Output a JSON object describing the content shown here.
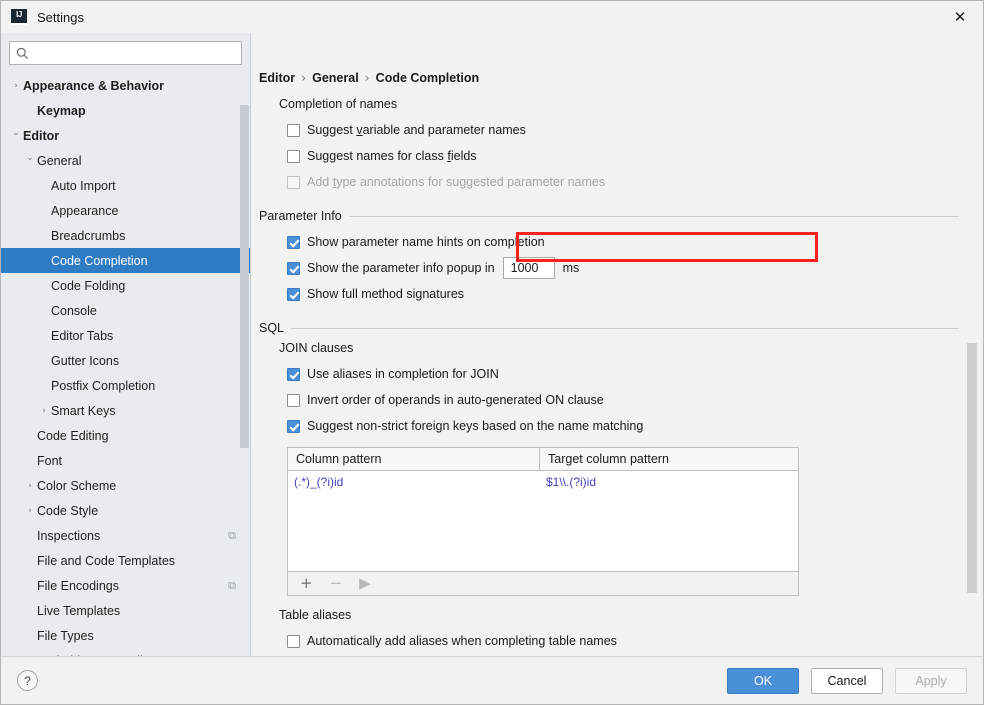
{
  "window": {
    "title": "Settings",
    "app_icon": "IJ",
    "close_icon": "✕"
  },
  "sidebar": {
    "search": {
      "value": "",
      "placeholder": "",
      "icon": "search-icon"
    },
    "items": [
      {
        "label": "Appearance & Behavior",
        "arrow": "›",
        "depth": 0,
        "bold": true,
        "selected": false,
        "badge": ""
      },
      {
        "label": "Keymap",
        "arrow": "",
        "depth": 1,
        "bold": true,
        "selected": false,
        "badge": ""
      },
      {
        "label": "Editor",
        "arrow": "⌄",
        "depth": 0,
        "bold": true,
        "selected": false,
        "badge": ""
      },
      {
        "label": "General",
        "arrow": "⌄",
        "depth": 1,
        "bold": false,
        "selected": false,
        "badge": ""
      },
      {
        "label": "Auto Import",
        "arrow": "",
        "depth": 2,
        "bold": false,
        "selected": false,
        "badge": ""
      },
      {
        "label": "Appearance",
        "arrow": "",
        "depth": 2,
        "bold": false,
        "selected": false,
        "badge": ""
      },
      {
        "label": "Breadcrumbs",
        "arrow": "",
        "depth": 2,
        "bold": false,
        "selected": false,
        "badge": ""
      },
      {
        "label": "Code Completion",
        "arrow": "",
        "depth": 2,
        "bold": false,
        "selected": true,
        "badge": ""
      },
      {
        "label": "Code Folding",
        "arrow": "",
        "depth": 2,
        "bold": false,
        "selected": false,
        "badge": ""
      },
      {
        "label": "Console",
        "arrow": "",
        "depth": 2,
        "bold": false,
        "selected": false,
        "badge": ""
      },
      {
        "label": "Editor Tabs",
        "arrow": "",
        "depth": 2,
        "bold": false,
        "selected": false,
        "badge": ""
      },
      {
        "label": "Gutter Icons",
        "arrow": "",
        "depth": 2,
        "bold": false,
        "selected": false,
        "badge": ""
      },
      {
        "label": "Postfix Completion",
        "arrow": "",
        "depth": 2,
        "bold": false,
        "selected": false,
        "badge": ""
      },
      {
        "label": "Smart Keys",
        "arrow": "›",
        "depth": 2,
        "bold": false,
        "selected": false,
        "badge": ""
      },
      {
        "label": "Code Editing",
        "arrow": "",
        "depth": 1,
        "bold": false,
        "selected": false,
        "badge": ""
      },
      {
        "label": "Font",
        "arrow": "",
        "depth": 1,
        "bold": false,
        "selected": false,
        "badge": ""
      },
      {
        "label": "Color Scheme",
        "arrow": "›",
        "depth": 1,
        "bold": false,
        "selected": false,
        "badge": ""
      },
      {
        "label": "Code Style",
        "arrow": "›",
        "depth": 1,
        "bold": false,
        "selected": false,
        "badge": ""
      },
      {
        "label": "Inspections",
        "arrow": "",
        "depth": 1,
        "bold": false,
        "selected": false,
        "badge": "⧉"
      },
      {
        "label": "File and Code Templates",
        "arrow": "",
        "depth": 1,
        "bold": false,
        "selected": false,
        "badge": ""
      },
      {
        "label": "File Encodings",
        "arrow": "",
        "depth": 1,
        "bold": false,
        "selected": false,
        "badge": "⧉"
      },
      {
        "label": "Live Templates",
        "arrow": "",
        "depth": 1,
        "bold": false,
        "selected": false,
        "badge": ""
      },
      {
        "label": "File Types",
        "arrow": "",
        "depth": 1,
        "bold": false,
        "selected": false,
        "badge": ""
      },
      {
        "label": "Android Layout Editor",
        "arrow": "",
        "depth": 1,
        "bold": false,
        "selected": false,
        "badge": ""
      }
    ]
  },
  "breadcrumb": {
    "items": [
      "Editor",
      "General",
      "Code Completion"
    ],
    "separator": "›"
  },
  "main": {
    "completion_of_names": {
      "title": "Completion of names",
      "options": [
        {
          "label_pre": "Suggest ",
          "label_mnemonic": "v",
          "label_post": "ariable and parameter names",
          "checked": false,
          "disabled": false
        },
        {
          "label_pre": "Suggest names for class ",
          "label_mnemonic": "f",
          "label_post": "ields",
          "checked": false,
          "disabled": false
        },
        {
          "label_pre": "Add ",
          "label_mnemonic": "t",
          "label_post": "ype annotations for suggested parameter names",
          "checked": false,
          "disabled": true
        }
      ]
    },
    "parameter_info": {
      "title": "Parameter Info",
      "highlighted_option": "Show parameter name hints on completion",
      "options": [
        {
          "label": "Show parameter name hints on completion",
          "checked": true,
          "highlighted": true
        },
        {
          "label": "Show the parameter info popup in",
          "checked": true,
          "spinner_value": "1000",
          "suffix": "ms"
        },
        {
          "label": "Show full method signatures",
          "checked": true
        }
      ]
    },
    "sql": {
      "title": "SQL",
      "join_clauses": {
        "title": "JOIN clauses",
        "options": [
          {
            "label": "Use aliases in completion for JOIN",
            "checked": true
          },
          {
            "label": "Invert order of operands in auto-generated ON clause",
            "checked": false
          },
          {
            "label": "Suggest non-strict foreign keys based on the name matching",
            "checked": true
          }
        ]
      },
      "table": {
        "headers": [
          "Column pattern",
          "Target column pattern"
        ],
        "rows": [
          {
            "column_pattern": "(.*)_(?i)id",
            "target_column_pattern": "$1\\\\.(?i)id"
          }
        ],
        "toolbar": {
          "add": "+",
          "remove": "−",
          "run": "▶"
        }
      },
      "table_aliases": {
        "title": "Table aliases",
        "options": [
          {
            "label": "Automatically add aliases when completing table names",
            "checked": false
          }
        ]
      }
    }
  },
  "footer": {
    "help_label": "?",
    "ok_label": "OK",
    "cancel_label": "Cancel",
    "apply_label": "Apply"
  },
  "colors": {
    "accent": "#4a90d9",
    "selection": "#2f7cc4",
    "highlight": "#f6221e",
    "sidebar_bg": "#e8ecf0",
    "panel_bg": "#f2f2f2"
  }
}
